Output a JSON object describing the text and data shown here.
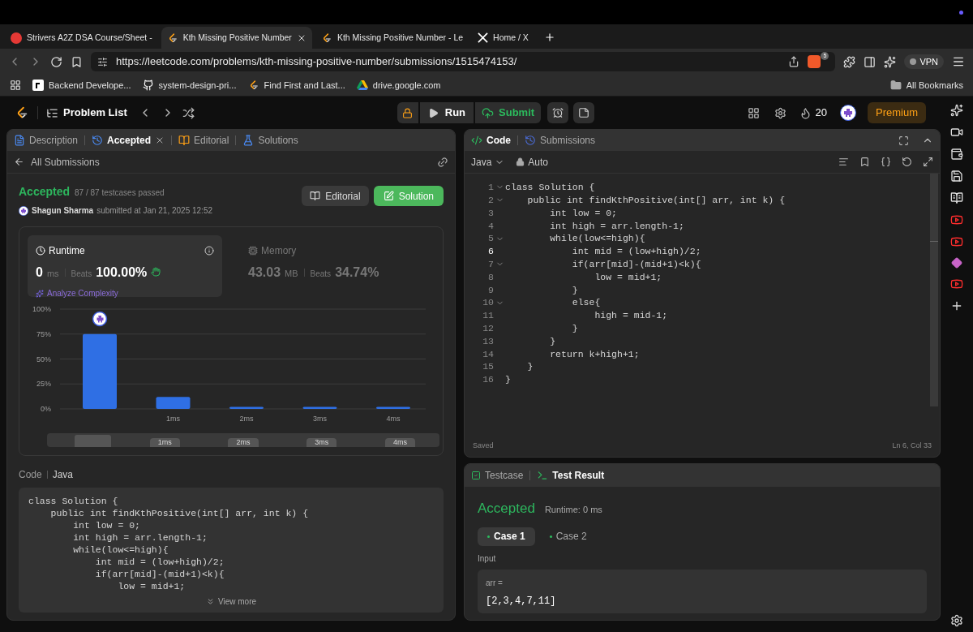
{
  "browser": {
    "tabs": [
      {
        "title": "Strivers A2Z DSA Course/Sheet -",
        "selected": false
      },
      {
        "title": "Kth Missing Positive Number",
        "selected": true
      },
      {
        "title": "Kth Missing Positive Number - Le",
        "selected": false
      },
      {
        "title": "Home / X",
        "selected": false
      }
    ],
    "url": "https://leetcode.com/problems/kth-missing-positive-number/submissions/1515474153/",
    "shield_badge": "5",
    "vpn": "VPN",
    "bookmarks": [
      "Backend Develope...",
      "system-design-pri...",
      "Find First and Last...",
      "drive.google.com"
    ],
    "all_bookmarks": "All Bookmarks"
  },
  "header": {
    "problem_list": "Problem List",
    "run": "Run",
    "submit": "Submit",
    "streak": "20",
    "premium": "Premium"
  },
  "left": {
    "tabs": [
      {
        "label": "Description",
        "selected": false,
        "closable": false
      },
      {
        "label": "Accepted",
        "selected": true,
        "closable": true
      },
      {
        "label": "Editorial",
        "selected": false,
        "closable": false
      },
      {
        "label": "Solutions",
        "selected": false,
        "closable": false
      }
    ],
    "back": "All Submissions",
    "submission": {
      "status": "Accepted",
      "testcases": "87 / 87 testcases passed",
      "user": "Shagun Sharma",
      "submitted": "submitted at Jan 21, 2025 12:52",
      "editorial": "Editorial",
      "solution": "Solution"
    },
    "metrics": [
      {
        "title": "Runtime",
        "value": "0",
        "unit": "ms",
        "beats_label": "Beats",
        "beats": "100.00%",
        "extra": "Analyze Complexity",
        "selected": true
      },
      {
        "title": "Memory",
        "value": "43.03",
        "unit": "MB",
        "beats_label": "Beats",
        "beats": "34.74%",
        "selected": false
      }
    ],
    "chart_data": {
      "type": "bar",
      "categories": [
        null,
        "1ms",
        "2ms",
        "3ms",
        "4ms"
      ],
      "series": [
        {
          "color": "#2f6fe4",
          "values": [
            75,
            12,
            2,
            2,
            2
          ]
        }
      ],
      "grid": true,
      "ylim": [
        0,
        100
      ],
      "yticks": [
        {
          "value": 0,
          "label": "0%"
        },
        {
          "value": 25,
          "label": "25%"
        },
        {
          "value": 50,
          "label": "50%"
        },
        {
          "value": 75,
          "label": "75%"
        },
        {
          "value": 100,
          "label": "100%"
        }
      ]
    },
    "range_slider": {
      "level": 0.07,
      "labels": [
        "1ms",
        "2ms",
        "3ms",
        "4ms"
      ]
    },
    "code": {
      "title": "Code",
      "language": "Java",
      "lines": [
        "class Solution {",
        "    public int findKthPositive(int[] arr, int k) {",
        "        int low = 0;",
        "        int high = arr.length-1;",
        "        while(low<=high){",
        "            int mid = (low+high)/2;",
        "            if(arr[mid]-(mid+1)<k){",
        "                low = mid+1;"
      ],
      "view_more": "View more"
    }
  },
  "editor": {
    "tabs": [
      {
        "label": "Code",
        "selected": true
      },
      {
        "label": "Submissions",
        "selected": false
      }
    ],
    "language": "Java",
    "mode": "Auto",
    "lines": [
      {
        "number": "1",
        "text": "class Solution {",
        "foldable": true,
        "active": false
      },
      {
        "number": "2",
        "text": "    public int findKthPositive(int[] arr, int k) {",
        "foldable": true,
        "active": false
      },
      {
        "number": "3",
        "text": "        int low = 0;",
        "foldable": false,
        "active": false
      },
      {
        "number": "4",
        "text": "        int high = arr.length-1;",
        "foldable": false,
        "active": false
      },
      {
        "number": "5",
        "text": "        while(low<=high){",
        "foldable": true,
        "active": false
      },
      {
        "number": "6",
        "text": "            int mid = (low+high)/2;",
        "foldable": false,
        "active": true
      },
      {
        "number": "7",
        "text": "            if(arr[mid]-(mid+1)<k){",
        "foldable": true,
        "active": false
      },
      {
        "number": "8",
        "text": "                low = mid+1;",
        "foldable": false,
        "active": false
      },
      {
        "number": "9",
        "text": "            }",
        "foldable": false,
        "active": false
      },
      {
        "number": "10",
        "text": "            else{",
        "foldable": true,
        "active": false
      },
      {
        "number": "11",
        "text": "                high = mid-1;",
        "foldable": false,
        "active": false
      },
      {
        "number": "12",
        "text": "            }",
        "foldable": false,
        "active": false
      },
      {
        "number": "13",
        "text": "        }",
        "foldable": false,
        "active": false
      },
      {
        "number": "14",
        "text": "        return k+high+1;",
        "foldable": false,
        "active": false
      },
      {
        "number": "15",
        "text": "    }",
        "foldable": false,
        "active": false
      },
      {
        "number": "16",
        "text": "}",
        "foldable": false,
        "active": false
      }
    ],
    "status": "Saved",
    "cursor": "Ln 6, Col 33"
  },
  "test": {
    "tabs": [
      {
        "label": "Testcase",
        "selected": false
      },
      {
        "label": "Test Result",
        "selected": true
      }
    ],
    "status": "Accepted",
    "runtime": "Runtime: 0 ms",
    "cases": [
      {
        "label": "Case 1",
        "selected": true
      },
      {
        "label": "Case 2",
        "selected": false
      }
    ],
    "input_label": "Input",
    "inputs": [
      {
        "name": "arr =",
        "value": "[2,3,4,7,11]"
      }
    ]
  }
}
